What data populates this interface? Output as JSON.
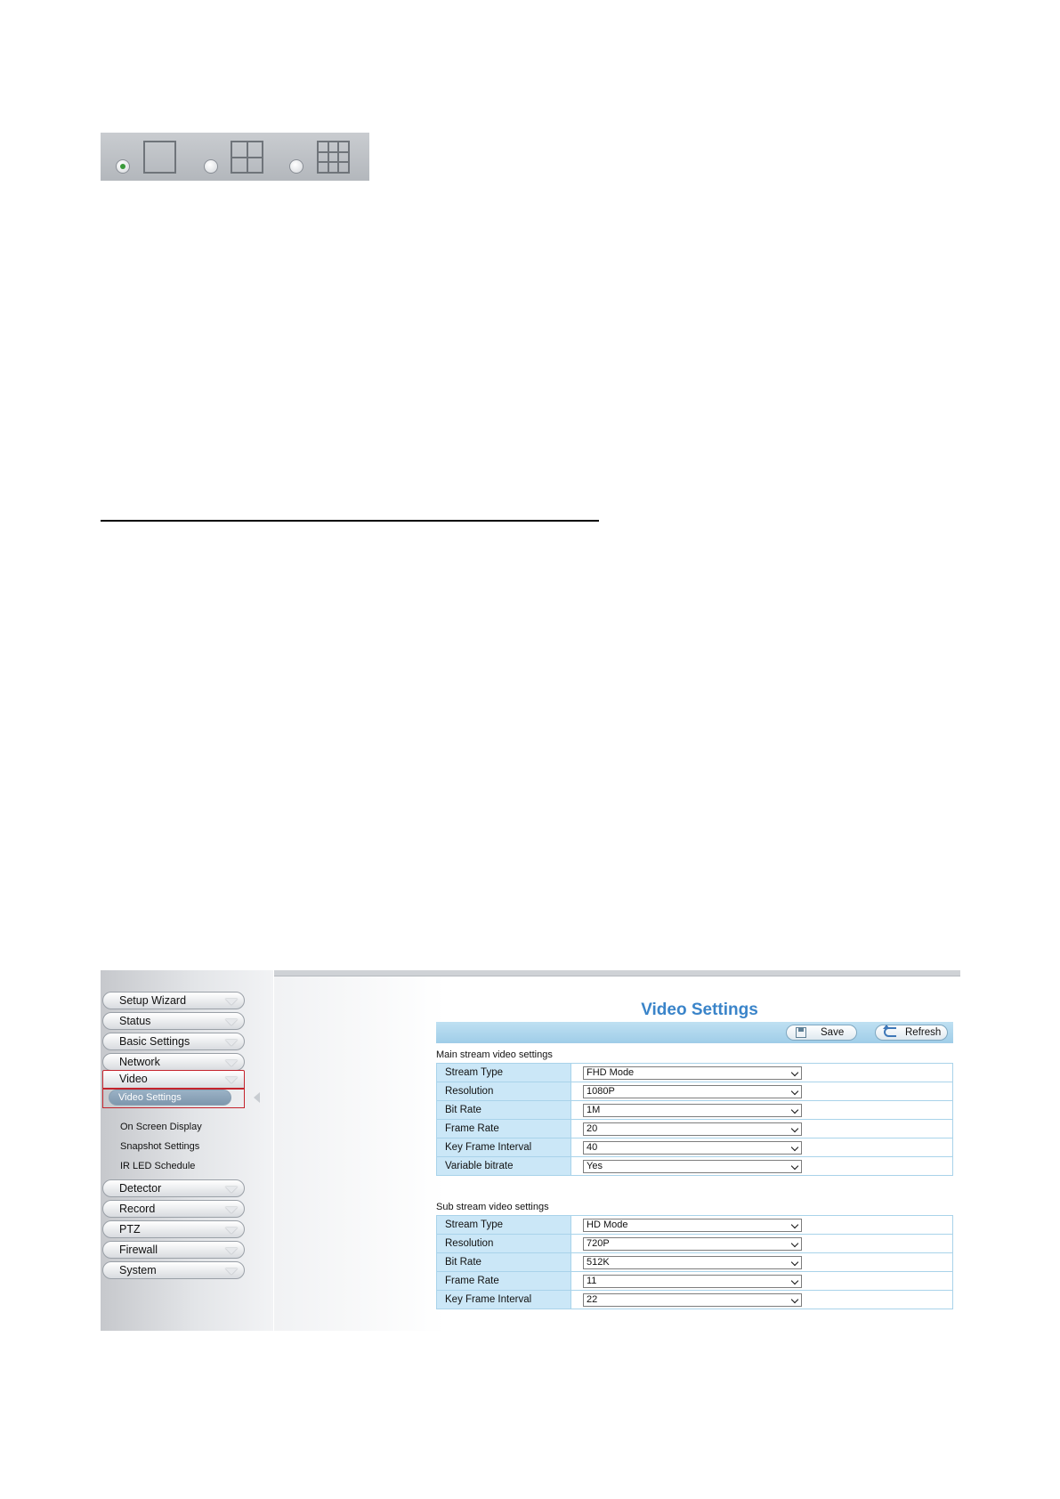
{
  "layout_selector": {
    "options": [
      {
        "name": "1-split",
        "checked": true
      },
      {
        "name": "4-split",
        "checked": false
      },
      {
        "name": "9-split",
        "checked": false
      }
    ]
  },
  "sidebar": {
    "top_items": [
      {
        "label": "Setup Wizard"
      },
      {
        "label": "Status"
      },
      {
        "label": "Basic Settings"
      },
      {
        "label": "Network"
      },
      {
        "label": "Video"
      }
    ],
    "video_sub_items": [
      {
        "label": "Video Settings",
        "active": true
      },
      {
        "label": "On Screen Display"
      },
      {
        "label": "Snapshot Settings"
      },
      {
        "label": "IR LED Schedule"
      }
    ],
    "bottom_items": [
      {
        "label": "Detector"
      },
      {
        "label": "Record"
      },
      {
        "label": "PTZ"
      },
      {
        "label": "Firewall"
      },
      {
        "label": "System"
      }
    ]
  },
  "page": {
    "title": "Video Settings",
    "toolbar": {
      "save_label": "Save",
      "refresh_label": "Refresh"
    }
  },
  "main_stream": {
    "title": "Main stream video settings",
    "rows": [
      {
        "label": "Stream Type",
        "value": "FHD Mode"
      },
      {
        "label": "Resolution",
        "value": "1080P"
      },
      {
        "label": "Bit Rate",
        "value": "1M"
      },
      {
        "label": "Frame Rate",
        "value": "20"
      },
      {
        "label": "Key Frame Interval",
        "value": "40"
      },
      {
        "label": "Variable bitrate",
        "value": "Yes"
      }
    ]
  },
  "sub_stream": {
    "title": "Sub stream video settings",
    "rows": [
      {
        "label": "Stream Type",
        "value": "HD Mode"
      },
      {
        "label": "Resolution",
        "value": "720P"
      },
      {
        "label": "Bit Rate",
        "value": "512K"
      },
      {
        "label": "Frame Rate",
        "value": "11"
      },
      {
        "label": "Key Frame Interval",
        "value": "22"
      }
    ]
  },
  "colors": {
    "title_blue": "#3a84c9",
    "highlight_red": "#c4232c",
    "label_cell_bg": "#cbe7f7",
    "toolbar_bg": "#a8d3eb"
  }
}
